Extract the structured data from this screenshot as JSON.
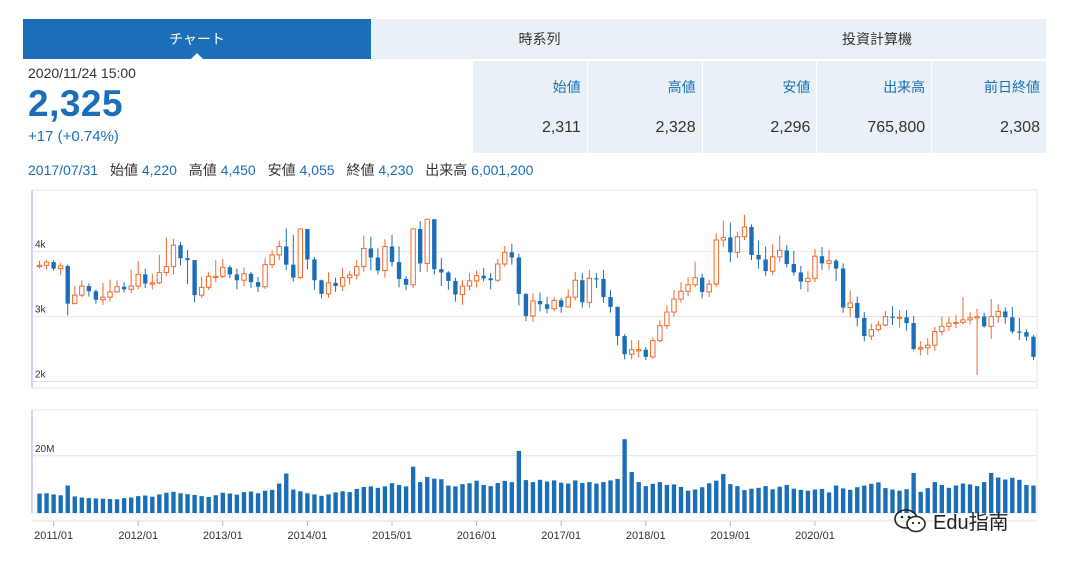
{
  "tabs": [
    {
      "label": "チャート",
      "active": true
    },
    {
      "label": "時系列",
      "active": false
    },
    {
      "label": "投資計算機",
      "active": false
    }
  ],
  "quote": {
    "datetime": "2020/11/24 15:00",
    "price": "2,325",
    "change": "+17 (+0.74%)",
    "stats": [
      {
        "label": "始値",
        "value": "2,311"
      },
      {
        "label": "高値",
        "value": "2,328"
      },
      {
        "label": "安値",
        "value": "2,296"
      },
      {
        "label": "出来高",
        "value": "765,800"
      },
      {
        "label": "前日終値",
        "value": "2,308"
      }
    ]
  },
  "hover_info": {
    "date": "2017/07/31",
    "open_label": "始値",
    "open": "4,220",
    "high_label": "高値",
    "high": "4,450",
    "low_label": "安値",
    "low": "4,055",
    "close_label": "終値",
    "close": "4,230",
    "volume_label": "出来高",
    "volume": "6,001,200"
  },
  "colors": {
    "accent": "#1b6fb8",
    "up": "#ee6a2c",
    "down": "#1b6fb8",
    "tab_bg": "#e9f1f7",
    "volume": "#1b6fb8"
  },
  "watermark": {
    "text": "Edu指南",
    "icon": "wechat-icon"
  },
  "chart_data": {
    "type": "candlestick",
    "price_axis": {
      "ticks": [
        "2k",
        "3k",
        "4k"
      ],
      "ylim": [
        1900,
        4950
      ]
    },
    "volume_axis": {
      "ticks": [
        "20M"
      ],
      "ylim": [
        0,
        36000000
      ]
    },
    "x_ticks": [
      "2011/01",
      "2012/01",
      "2013/01",
      "2014/01",
      "2015/01",
      "2016/01",
      "2017/01",
      "2018/01",
      "2019/01",
      "2020/01"
    ],
    "x_start": "2010/11",
    "interval": "monthly",
    "closes": [
      3790,
      3840,
      3740,
      3780,
      3200,
      3330,
      3470,
      3390,
      3260,
      3300,
      3380,
      3460,
      3420,
      3470,
      3650,
      3510,
      3520,
      3680,
      3770,
      4100,
      3900,
      3870,
      3330,
      3450,
      3620,
      3620,
      3760,
      3650,
      3560,
      3660,
      3530,
      3460,
      3800,
      3950,
      4080,
      3800,
      3600,
      4350,
      3880,
      3560,
      3350,
      3520,
      3470,
      3600,
      3640,
      3770,
      4050,
      3910,
      3710,
      4080,
      3840,
      3580,
      3490,
      4350,
      3820,
      4500,
      3730,
      3680,
      3550,
      3340,
      3470,
      3550,
      3630,
      3590,
      3560,
      3810,
      3990,
      3910,
      3350,
      3010,
      3240,
      3190,
      3120,
      3250,
      3150,
      3300,
      3560,
      3220,
      3590,
      3580,
      3300,
      3150,
      2700,
      2420,
      2490,
      2490,
      2380,
      2630,
      2860,
      3070,
      3270,
      3390,
      3490,
      3600,
      3380,
      3500,
      4180,
      4220,
      3990,
      4230,
      4380,
      3950,
      3880,
      3700,
      3920,
      4020,
      3810,
      3680,
      3540,
      3590,
      3930,
      3820,
      3860,
      3740,
      3140,
      3210,
      2980,
      2700,
      2800,
      2870,
      3000,
      2980,
      2990,
      2900,
      2500,
      2520,
      2560,
      2770,
      2850,
      2900,
      2910,
      2950,
      2980,
      3000,
      2850,
      3000,
      3080,
      2990,
      2770,
      2760,
      2690,
      2380
    ],
    "highs": [
      3860,
      3870,
      3870,
      3830,
      3800,
      3470,
      3560,
      3510,
      3420,
      3520,
      3570,
      3560,
      3530,
      3720,
      3860,
      3740,
      3660,
      3950,
      4220,
      4200,
      4150,
      4030,
      3870,
      3620,
      3690,
      3870,
      3890,
      3790,
      3740,
      3760,
      3690,
      3610,
      3900,
      4020,
      4170,
      4360,
      4260,
      4350,
      4350,
      3920,
      3570,
      3680,
      3600,
      3750,
      3700,
      3870,
      4250,
      4230,
      4050,
      4190,
      4260,
      4080,
      3620,
      4360,
      4470,
      4500,
      4460,
      3900,
      3700,
      3600,
      3560,
      3670,
      3710,
      3750,
      3670,
      3890,
      4090,
      4120,
      3970,
      3360,
      3360,
      3370,
      3300,
      3300,
      3290,
      3420,
      3690,
      3670,
      3720,
      3670,
      3720,
      3410,
      3150,
      2730,
      2640,
      2640,
      2530,
      2680,
      2940,
      3170,
      3410,
      3530,
      3610,
      3850,
      3660,
      3570,
      4280,
      4480,
      4450,
      4310,
      4570,
      4420,
      4170,
      4080,
      4120,
      4250,
      4100,
      4010,
      3780,
      3700,
      4040,
      4070,
      4030,
      3890,
      3820,
      3400,
      3310,
      3070,
      2890,
      2930,
      3090,
      3160,
      3100,
      3100,
      3010,
      2620,
      2670,
      2840,
      3000,
      3000,
      3030,
      3300,
      3070,
      3120,
      3060,
      3270,
      3190,
      3140,
      3150,
      2980,
      2800,
      2720
    ],
    "lows": [
      3740,
      3730,
      3710,
      3640,
      3020,
      3190,
      3300,
      3310,
      3200,
      3180,
      3230,
      3380,
      3370,
      3360,
      3420,
      3440,
      3420,
      3500,
      3620,
      3650,
      3790,
      3500,
      3220,
      3290,
      3410,
      3530,
      3590,
      3590,
      3420,
      3470,
      3440,
      3380,
      3420,
      3750,
      3870,
      3720,
      3540,
      3580,
      3730,
      3410,
      3280,
      3290,
      3380,
      3390,
      3490,
      3570,
      3690,
      3710,
      3650,
      3600,
      3770,
      3450,
      3410,
      3440,
      3690,
      3690,
      3650,
      3470,
      3410,
      3230,
      3180,
      3400,
      3450,
      3540,
      3420,
      3530,
      3770,
      3800,
      3170,
      2930,
      2920,
      3080,
      3050,
      3080,
      3060,
      3140,
      3250,
      3140,
      3140,
      3440,
      3210,
      3060,
      2560,
      2340,
      2340,
      2370,
      2330,
      2350,
      2600,
      2810,
      3000,
      3220,
      3310,
      3450,
      3280,
      3300,
      3460,
      4070,
      3840,
      3900,
      4180,
      3870,
      3740,
      3630,
      3640,
      3840,
      3760,
      3630,
      3420,
      3380,
      3530,
      3720,
      3720,
      3550,
      3060,
      2990,
      2850,
      2620,
      2640,
      2770,
      2850,
      2870,
      2830,
      2780,
      2480,
      2400,
      2410,
      2470,
      2710,
      2780,
      2820,
      2880,
      2880,
      2100,
      2830,
      2660,
      2900,
      2890,
      2740,
      2640,
      2630,
      2330
    ],
    "volumes": [
      6800000,
      6900000,
      6500000,
      6200000,
      9600000,
      5800000,
      5400000,
      5200000,
      5100000,
      5000000,
      4900000,
      4800000,
      5200000,
      5400000,
      5900000,
      6100000,
      5700000,
      6500000,
      7100000,
      7400000,
      6900000,
      6600000,
      6300000,
      5900000,
      5600000,
      6200000,
      7100000,
      6800000,
      6400000,
      7300000,
      7500000,
      6900000,
      7800000,
      8100000,
      10300000,
      13800000,
      8200000,
      7600000,
      6900000,
      6500000,
      6000000,
      6500000,
      7200000,
      7600000,
      7300000,
      8400000,
      9100000,
      9300000,
      8800000,
      9300000,
      10400000,
      9800000,
      9300000,
      16200000,
      10800000,
      12600000,
      12000000,
      11800000,
      9600000,
      9300000,
      10100000,
      10400000,
      11300000,
      9800000,
      9400000,
      10500000,
      11200000,
      10800000,
      21700000,
      11500000,
      10800000,
      11600000,
      11000000,
      11400000,
      10600000,
      10300000,
      11400000,
      10500000,
      10800000,
      10300000,
      10800000,
      11400000,
      11900000,
      25800000,
      14300000,
      10800000,
      9400000,
      10200000,
      10800000,
      9800000,
      10000000,
      9100000,
      7800000,
      8200000,
      9000000,
      10400000,
      11300000,
      13600000,
      10100000,
      9400000,
      8000000,
      8500000,
      8800000,
      9400000,
      8300000,
      9200000,
      9800000,
      8500000,
      8100000,
      7800000,
      8200000,
      8400000,
      7200000,
      9600000,
      8600000,
      8100000,
      9000000,
      9600000,
      10200000,
      10700000,
      8700000,
      8200000,
      7800000,
      8300000,
      14000000,
      7400000,
      8700000,
      10800000,
      9800000,
      8800000,
      9600000,
      10300000,
      10000000,
      9400000,
      10800000,
      14000000,
      12400000,
      11700000,
      12300000,
      11600000,
      9800000,
      9600000,
      9600000,
      12600000
    ]
  }
}
